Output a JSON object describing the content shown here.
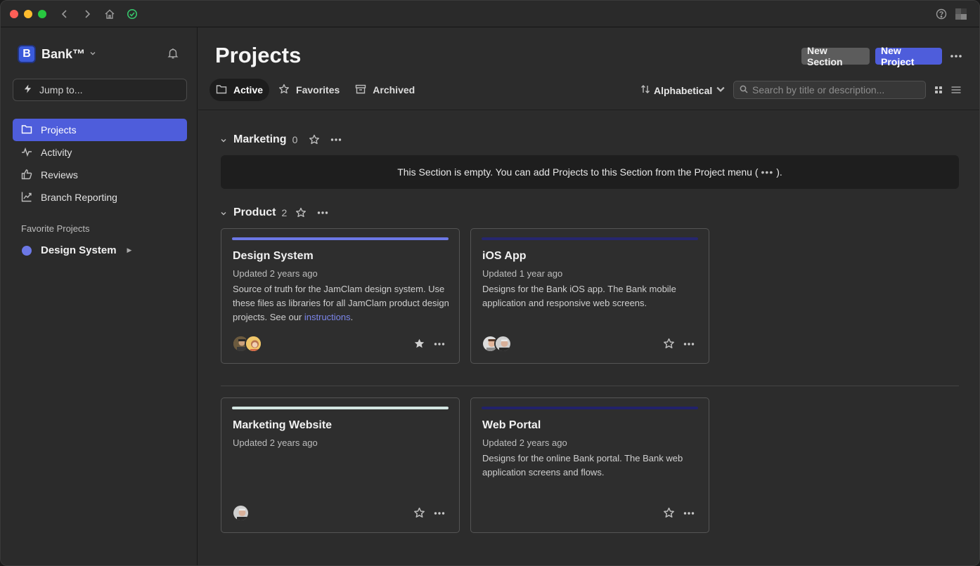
{
  "app": {
    "team_name": "Bank™",
    "team_logo_letter": "B",
    "jump_placeholder": "Jump to...",
    "titlebar_icons": [
      "chevron-left-icon",
      "chevron-right-icon",
      "home-icon",
      "check-circle-icon",
      "help-icon"
    ]
  },
  "sidebar": {
    "items": [
      {
        "label": "Projects",
        "icon": "folder-icon",
        "active": true
      },
      {
        "label": "Activity",
        "icon": "activity-icon",
        "active": false
      },
      {
        "label": "Reviews",
        "icon": "thumbs-up-icon",
        "active": false
      },
      {
        "label": "Branch Reporting",
        "icon": "chart-icon",
        "active": false
      }
    ],
    "favorites_heading": "Favorite Projects",
    "favorites": [
      {
        "label": "Design System",
        "color": "#6c78e6"
      }
    ]
  },
  "header": {
    "title": "Projects",
    "new_section_label": "New Section",
    "new_project_label": "New Project",
    "tabs": [
      {
        "label": "Active",
        "icon": "folder-icon",
        "active": true
      },
      {
        "label": "Favorites",
        "icon": "star-icon",
        "active": false
      },
      {
        "label": "Archived",
        "icon": "archive-icon",
        "active": false
      }
    ],
    "sort_label": "Alphabetical",
    "search_placeholder": "Search by title or description..."
  },
  "sections": [
    {
      "name": "Marketing",
      "count": "0",
      "empty_text_before": "This Section is empty. You can add Projects to this Section from the Project menu (",
      "empty_text_after": ")."
    },
    {
      "name": "Product",
      "count": "2"
    }
  ],
  "cards": [
    {
      "title": "Design System",
      "updated": "Updated 2 years ago",
      "desc": "Source of truth for the JamClam design system. Use these files as libraries for all JamClam product design projects. See our ",
      "link": "instructions",
      "desc_tail": ".",
      "bar_color": "#6c78e6",
      "favorited": true
    },
    {
      "title": "iOS App",
      "updated": "Updated 1 year ago",
      "desc": "Designs for the Bank iOS app. The Bank mobile application and responsive web screens.",
      "bar_color": "#26266e",
      "favorited": false
    },
    {
      "title": "Marketing Website",
      "updated": "Updated 2 years ago",
      "desc": "",
      "bar_color": "#d4e6e2",
      "favorited": false
    },
    {
      "title": "Web Portal",
      "updated": "Updated 2 years ago",
      "desc": "Designs for the online Bank portal. The Bank web application screens and flows.",
      "bar_color": "#22226a",
      "favorited": false
    }
  ],
  "colors": {
    "accent": "#4e5ddb",
    "background": "#2c2c2c"
  }
}
